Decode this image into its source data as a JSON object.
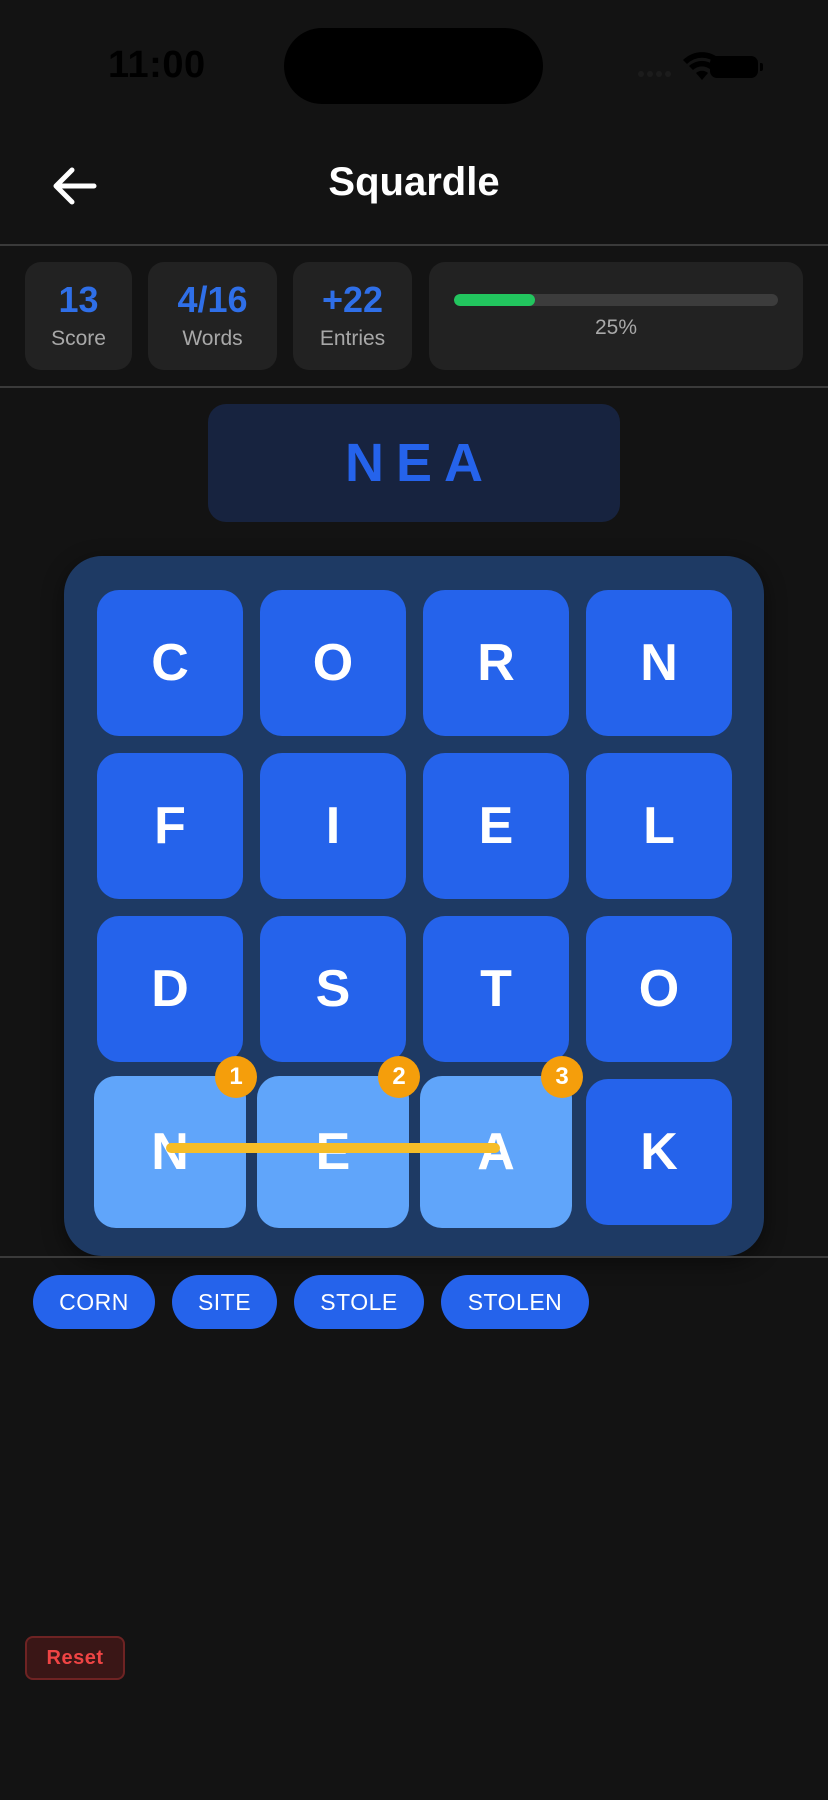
{
  "status_bar": {
    "time": "11:00"
  },
  "header": {
    "title": "Squardle"
  },
  "stats": {
    "score_value": "13",
    "score_label": "Score",
    "words_value": "4/16",
    "words_label": "Words",
    "entries_value": "+22",
    "entries_label": "Entries",
    "progress_percent": 25,
    "progress_label": "25%"
  },
  "current_word": "NEA",
  "board": {
    "rows": [
      [
        "C",
        "O",
        "R",
        "N"
      ],
      [
        "F",
        "I",
        "E",
        "L"
      ],
      [
        "D",
        "S",
        "T",
        "O"
      ],
      [
        "N",
        "E",
        "A",
        "K"
      ]
    ],
    "selected_path": [
      {
        "row": 3,
        "col": 0,
        "order": "1"
      },
      {
        "row": 3,
        "col": 1,
        "order": "2"
      },
      {
        "row": 3,
        "col": 2,
        "order": "3"
      }
    ]
  },
  "found_words": [
    "CORN",
    "SITE",
    "STOLE",
    "STOLEN"
  ],
  "reset_label": "Reset",
  "colors": {
    "tile": "#2563eb",
    "tile_selected": "#60a5fa",
    "path": "#f6bd28",
    "badge": "#f59e0b",
    "progress": "#22c55e"
  }
}
